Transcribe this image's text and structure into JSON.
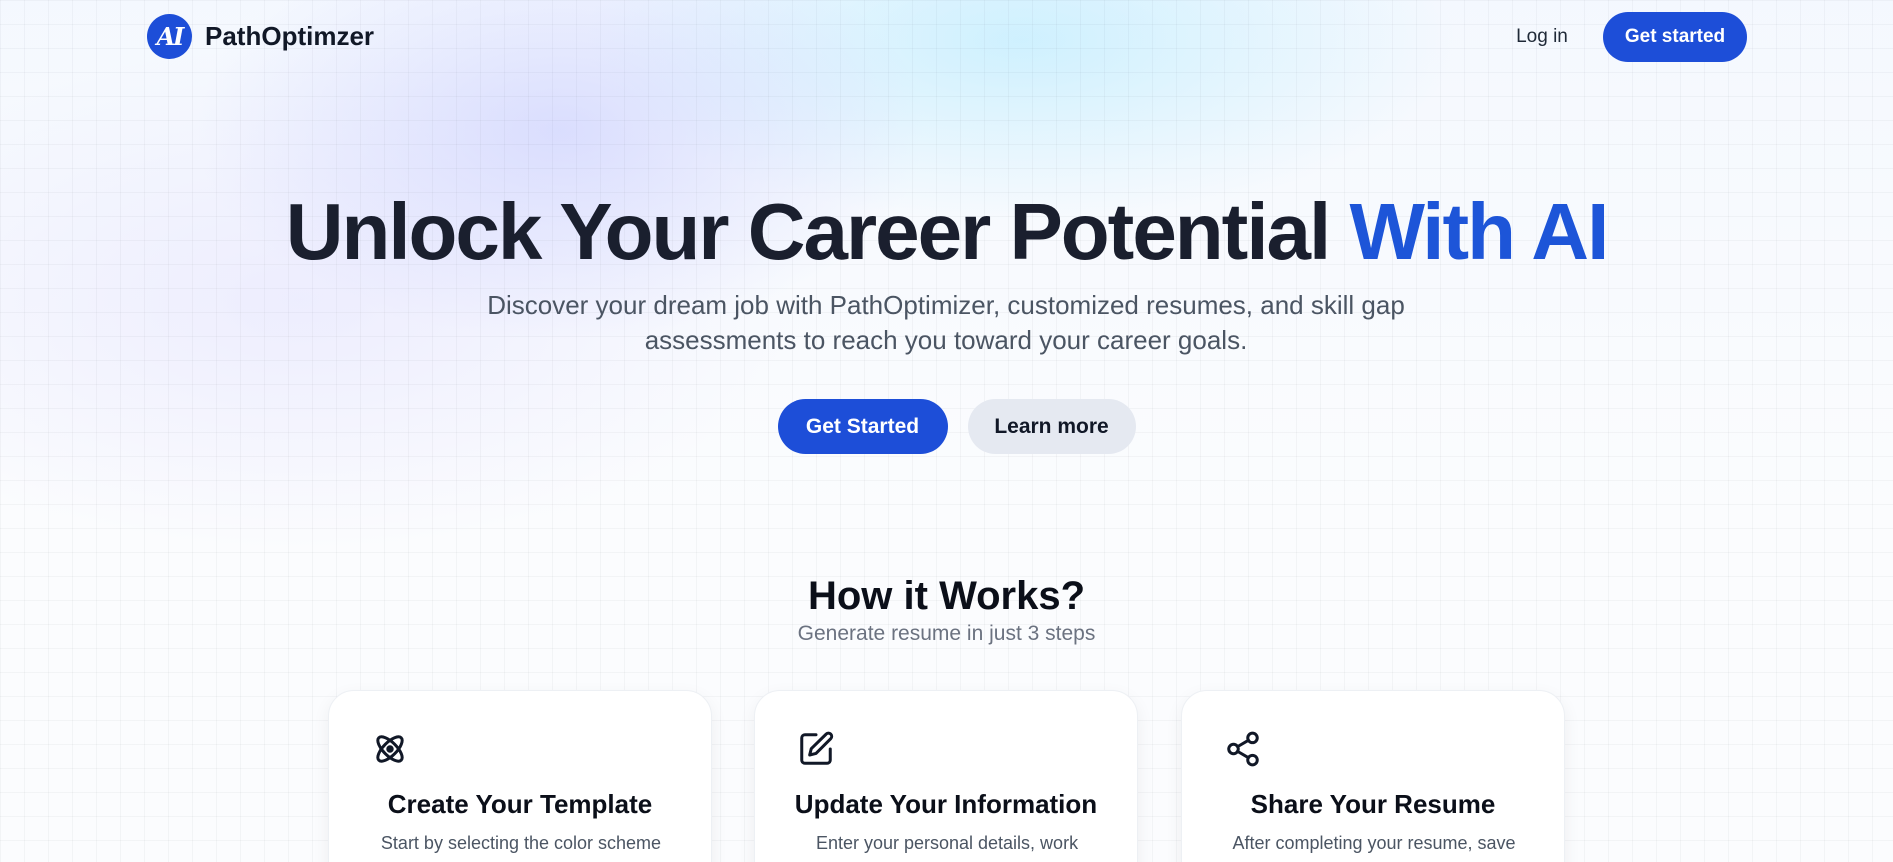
{
  "header": {
    "logo_mark": "AI",
    "brand": "PathOptimzer",
    "login_label": "Log in",
    "get_started_label": "Get started"
  },
  "hero": {
    "title_main": "Unlock Your Career Potential",
    "title_accent": "With AI",
    "subtitle": "Discover your dream job with PathOptimizer, customized resumes, and skill gap assessments to reach you toward your career goals.",
    "primary_cta": "Get Started",
    "secondary_cta": "Learn more"
  },
  "how_it_works": {
    "title": "How it Works?",
    "subtitle": "Generate resume in just 3 steps",
    "steps": [
      {
        "icon": "atom-icon",
        "title": "Create Your Template",
        "body": "Start by selecting the color scheme"
      },
      {
        "icon": "edit-icon",
        "title": "Update Your Information",
        "body": "Enter your personal details, work"
      },
      {
        "icon": "share-icon",
        "title": "Share Your Resume",
        "body": "After completing your resume, save"
      }
    ]
  },
  "colors": {
    "accent": "#1d4ed8",
    "accent_text": "#1d55d8",
    "heading": "#1a1f2e",
    "muted": "#4b5563"
  }
}
